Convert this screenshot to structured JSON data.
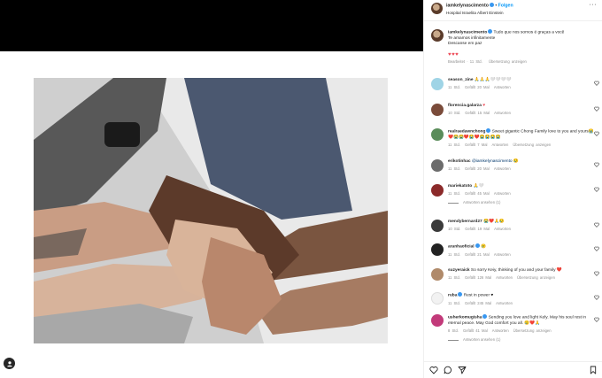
{
  "post": {
    "username": "iamkelynascimento",
    "follow_label": "Folgen",
    "location": "Hospital Israelita Albert Einstein"
  },
  "caption": {
    "username": "iamkelynascimento",
    "text_line1": "Tudo que nos somos é graças a você",
    "text_line2": "Te amamos infinitamente",
    "text_line3": "Descanse em paz",
    "hearts": "♥♥♥",
    "meta_edited": "Bearbeitet · 11 Std.",
    "meta_translate": "Übersetzung anzeigen"
  },
  "comments": [
    {
      "user": "season_zine",
      "text": "🙏🙏🙏🤍🤍🤍🤍",
      "time": "11 Std.",
      "likes": "Gefällt 20 Mal",
      "reply": "Antworten",
      "translate": "",
      "avatar": "#9fd4e6"
    },
    {
      "user": "florencia.galarza",
      "text": "♥",
      "time": "10 Std.",
      "likes": "Gefällt 15 Mal",
      "reply": "Antworten",
      "translate": "",
      "avatar": "#7a4b3a"
    },
    {
      "user": "realraedawnchong",
      "text": "Sweet gigantic Chong Family love to you and yours😭❤️😭😭❤️😭❤️😭😭😭😭",
      "time": "11 Std.",
      "likes": "Gefällt 7 Mal",
      "reply": "Antworten",
      "translate": "Übersetzung anzeigen",
      "avatar": "#5a8c5a"
    },
    {
      "user": "erikotinhac",
      "text": "@iamkelynascimento 😢",
      "time": "11 Std.",
      "likes": "Gefällt 20 Mal",
      "reply": "Antworten",
      "translate": "",
      "avatar": "#6c6c6c"
    },
    {
      "user": "mariekatoto",
      "text": "🙏🤍",
      "time": "11 Std.",
      "likes": "Gefällt 45 Mal",
      "reply": "Antworten",
      "translate": "",
      "avatar": "#8b2a2a",
      "replies": "Antworten ansehen (1)"
    },
    {
      "user": "mendybernard27",
      "text": "😭❤️🙏😢",
      "time": "10 Std.",
      "likes": "Gefällt 19 Mal",
      "reply": "Antworten",
      "translate": "",
      "avatar": "#3a3a3a"
    },
    {
      "user": "aranhaoficial",
      "text": "😢",
      "time": "11 Std.",
      "likes": "Gefällt 21 Mal",
      "reply": "Antworten",
      "translate": "",
      "avatar": "#222222"
    },
    {
      "user": "suzyeraick",
      "text": "So sorry Keiy, thinking of you and your family ❤️",
      "time": "11 Std.",
      "likes": "Gefällt 126 Mal",
      "reply": "Antworten",
      "translate": "Übersetzung anzeigen",
      "avatar": "#b08a6a"
    },
    {
      "user": "ruba",
      "text": "Rest in power ♥",
      "time": "11 Std.",
      "likes": "Gefällt 245 Mal",
      "reply": "Antworten",
      "translate": "",
      "avatar": "#f2f2f2"
    },
    {
      "user": "usherkomugisha",
      "text": "Sending you love and light Kely. May his soul rest in eternal peace. May God comfort you all. 😢❤️🙏",
      "time": "8 Std.",
      "likes": "Gefällt 41 Mal",
      "reply": "Antworten",
      "translate": "Übersetzung anzeigen",
      "avatar": "#c23a7a",
      "replies": "Antworten ansehen (1)"
    }
  ],
  "colors": {
    "accent": "#0095f6",
    "verified": "#3897f0",
    "heart_red": "#ed4956",
    "meta_gray": "#8e8e8e"
  },
  "icons": {
    "like": "heart-outline-icon",
    "comment": "comment-bubble-icon",
    "share": "paper-plane-icon",
    "save": "bookmark-icon",
    "tags": "user-tag-icon"
  }
}
